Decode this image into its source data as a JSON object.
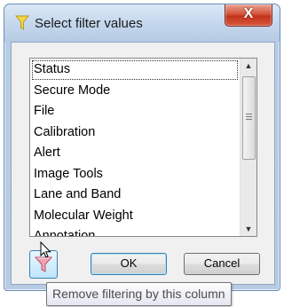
{
  "dialog": {
    "title": "Select filter values",
    "close_label": "X"
  },
  "list": {
    "items": [
      "Status",
      "Secure Mode",
      "File",
      "Calibration",
      "Alert",
      "Image Tools",
      "Lane and Band",
      "Molecular Weight",
      "Annotation"
    ]
  },
  "buttons": {
    "ok_label": "OK",
    "cancel_label": "Cancel",
    "filter_icon": "funnel-remove-icon"
  },
  "tooltip": {
    "text": "Remove filtering by this column"
  },
  "colors": {
    "accent": "#3c7fb1",
    "close": "#c2331b",
    "funnel": "#f0a0b0"
  }
}
